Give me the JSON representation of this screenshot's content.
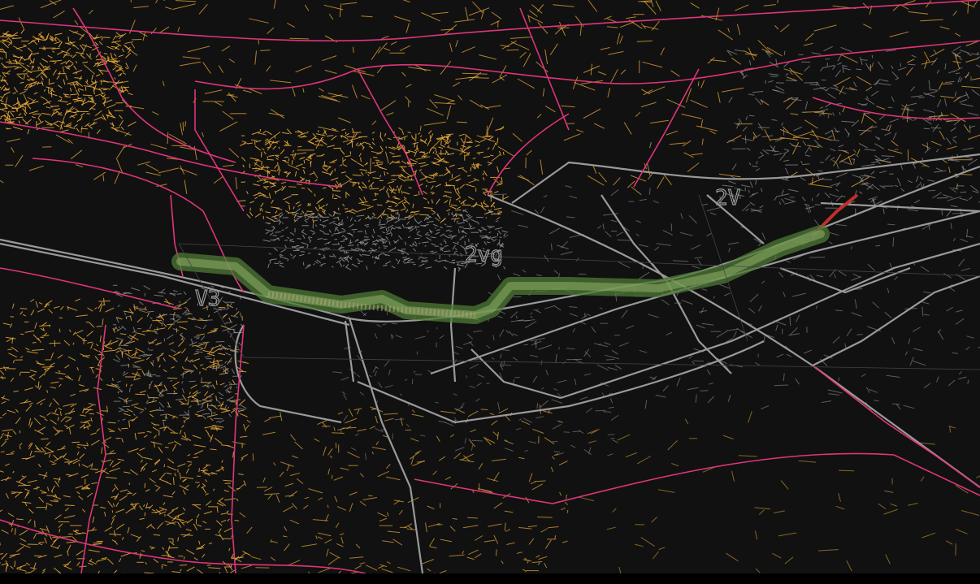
{
  "map": {
    "labels": {
      "survey_label_center": "2vg",
      "survey_label_right": "2V",
      "survey_label_left": "V3"
    },
    "layers": [
      {
        "name": "minor-network",
        "color": "#e8a838"
      },
      {
        "name": "primary-network",
        "color": "#e0357a"
      },
      {
        "name": "urban-network",
        "color": "#9a9a9a"
      },
      {
        "name": "survey-corridor",
        "color": "#6b9a4a"
      }
    ],
    "colors": {
      "background": "#111111",
      "orange": "#e8a838",
      "magenta": "#e0357a",
      "grey": "#9a9a9a",
      "green": "#6b9a4a",
      "red": "#c0302a"
    }
  }
}
